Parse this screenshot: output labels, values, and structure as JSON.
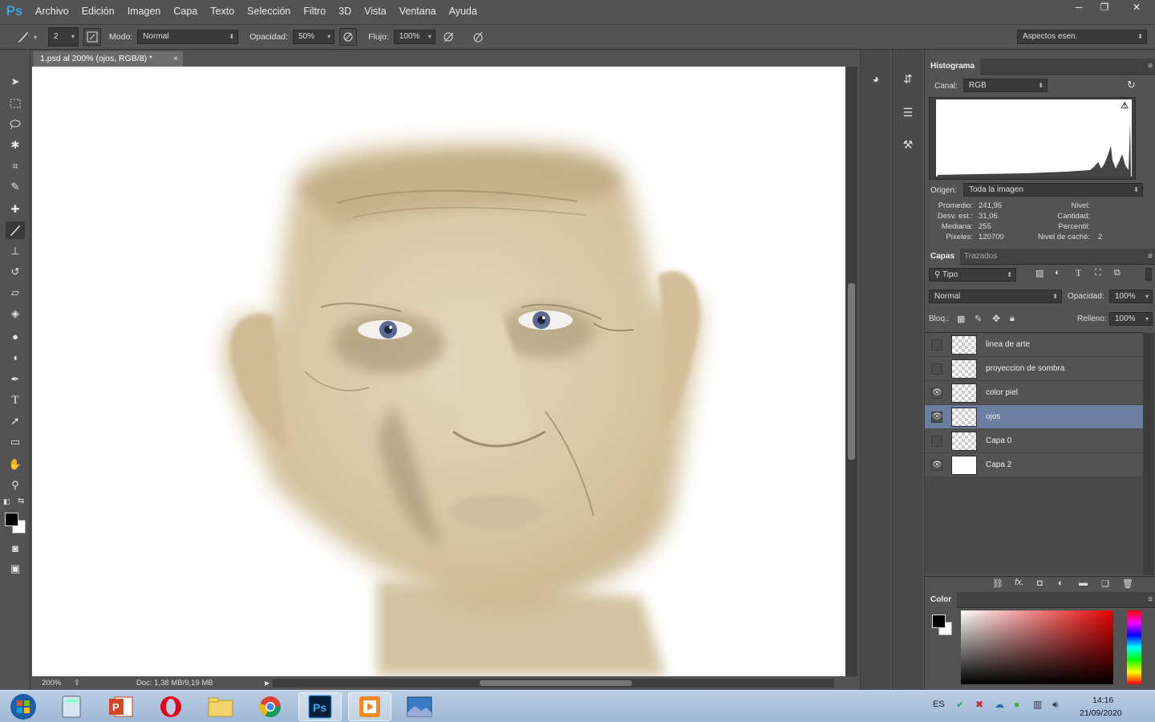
{
  "app": {
    "logo": "Ps"
  },
  "menu": [
    "Archivo",
    "Edición",
    "Imagen",
    "Capa",
    "Texto",
    "Selección",
    "Filtro",
    "3D",
    "Vista",
    "Ventana",
    "Ayuda"
  ],
  "window_controls": {
    "minimize": "─",
    "restore": "❐",
    "close": "✕"
  },
  "options": {
    "brush_size": "2",
    "mode_label": "Modo:",
    "mode_value": "Normal",
    "opacity_label": "Opacidad:",
    "opacity_value": "50%",
    "flow_label": "Flujo:",
    "flow_value": "100%",
    "workspace": "Aspectos esen."
  },
  "document": {
    "tab_title": "1.psd al 200% (ojos, RGB/8) *",
    "close": "×",
    "zoom": "200%",
    "doc_size": "Doc: 1,38 MB/9,19 MB"
  },
  "histogram": {
    "tab": "Histograma",
    "channel_label": "Canal:",
    "channel_value": "RGB",
    "source_label": "Origen:",
    "source_value": "Toda la imagen",
    "stats_left": [
      {
        "label": "Promedio:",
        "value": "241,95"
      },
      {
        "label": "Desv. est.:",
        "value": "31,06"
      },
      {
        "label": "Mediana:",
        "value": "255"
      },
      {
        "label": "Píxeles:",
        "value": "120700"
      }
    ],
    "stats_right": [
      {
        "label": "Nivel:",
        "value": ""
      },
      {
        "label": "Cantidad:",
        "value": ""
      },
      {
        "label": "Percentil:",
        "value": ""
      },
      {
        "label": "Nivel de caché:",
        "value": "2"
      }
    ]
  },
  "layers_panel": {
    "tabs": [
      "Capas",
      "Trazados"
    ],
    "filter": "Tipo",
    "blend_mode": "Normal",
    "opacity_label": "Opacidad:",
    "opacity_value": "100%",
    "lock_label": "Bloq.:",
    "fill_label": "Relleno:",
    "fill_value": "100%",
    "layers": [
      {
        "name": "linea de arte",
        "visible": false,
        "selected": false
      },
      {
        "name": "proyeccion de sombra",
        "visible": false,
        "selected": false
      },
      {
        "name": "color piel",
        "visible": true,
        "selected": false
      },
      {
        "name": "ojos",
        "visible": true,
        "selected": true
      },
      {
        "name": "Capa 0",
        "visible": false,
        "selected": false
      },
      {
        "name": "Capa 2",
        "visible": true,
        "selected": false
      }
    ]
  },
  "color_panel": {
    "tab": "Color"
  },
  "taskbar": {
    "language": "ES",
    "time": "14:16",
    "date": "21/09/2020",
    "apps": [
      "windows-start",
      "calculator",
      "powerpoint",
      "opera",
      "file-explorer",
      "chrome",
      "photoshop",
      "media-player",
      "photos"
    ]
  },
  "colors": {
    "accent_selected_layer": "#6b7ea0",
    "ps_blue": "#3fa0e0"
  }
}
